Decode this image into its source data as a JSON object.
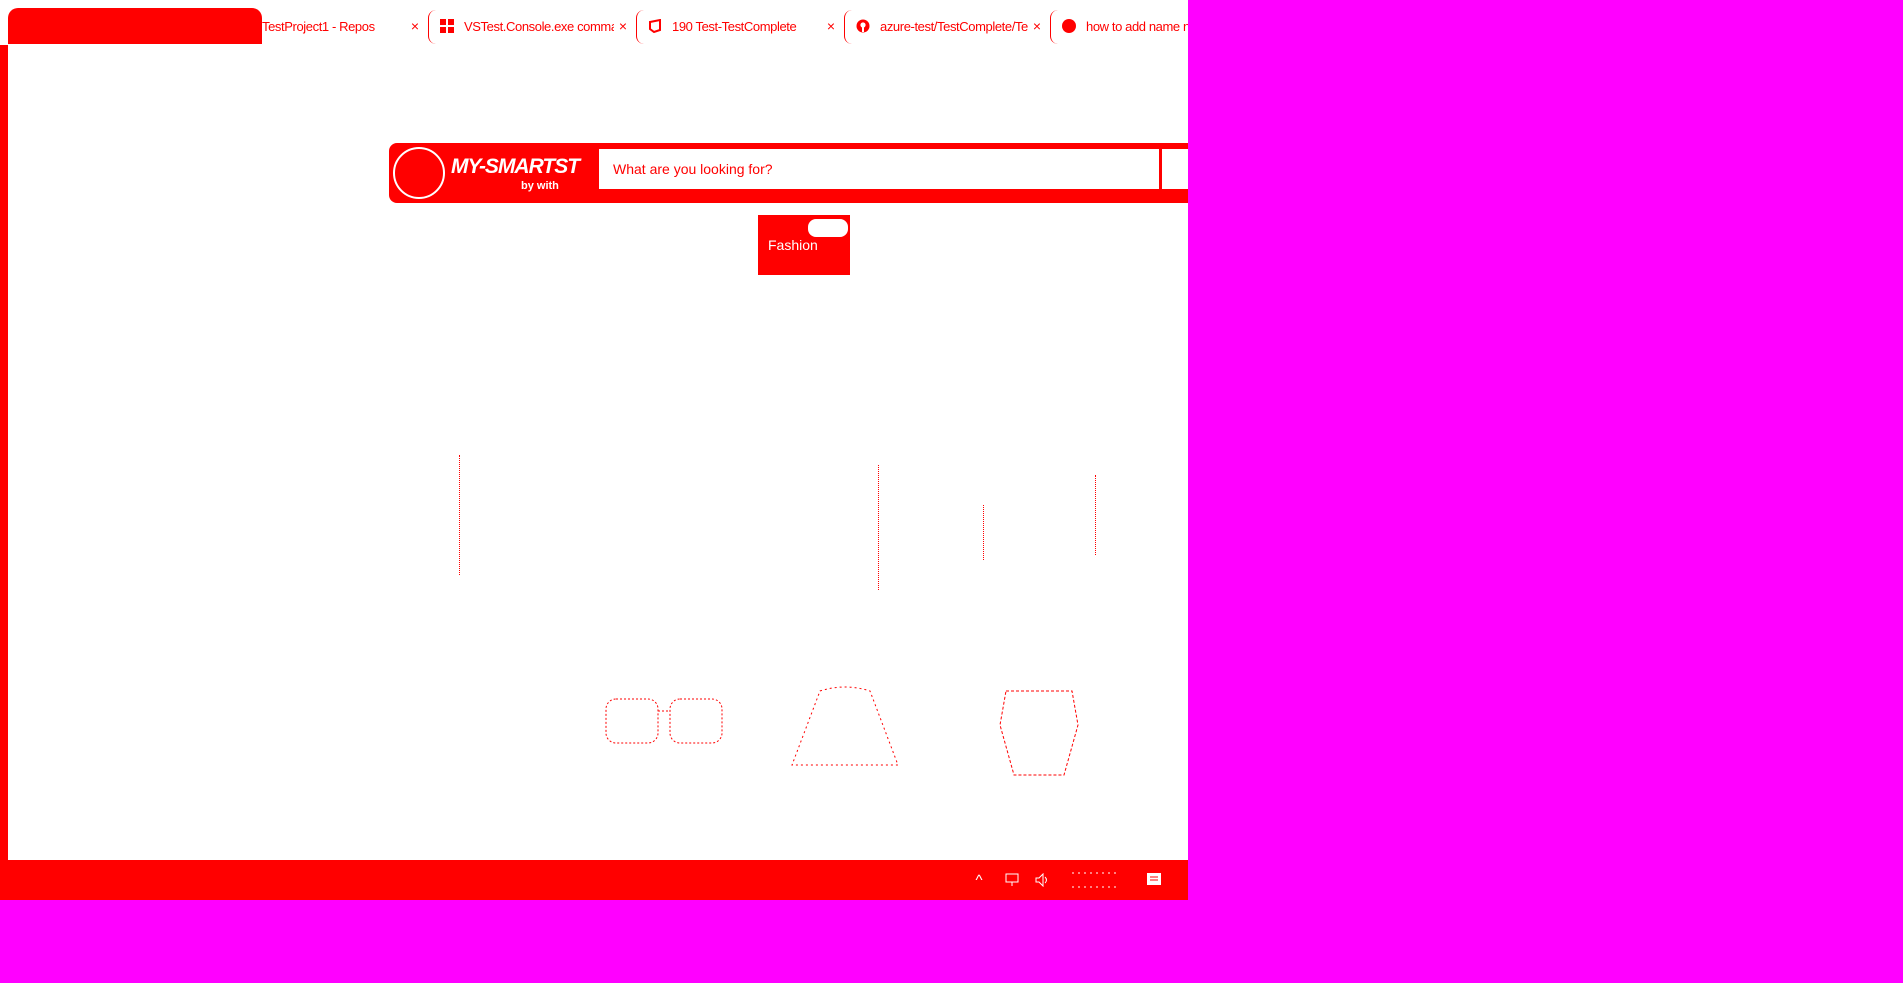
{
  "browser": {
    "tabs": [
      {
        "label": "",
        "active": true
      },
      {
        "label": "TestProject1 - Repos",
        "active": false,
        "icon": "azure-devops-icon"
      },
      {
        "label": "VSTest.Console.exe comma",
        "active": false,
        "icon": "windows-logo-icon"
      },
      {
        "label": "190 Test-TestComplete",
        "active": false,
        "icon": "testcomplete-icon"
      },
      {
        "label": "azure-test/TestComplete/Te",
        "active": false,
        "icon": "github-icon"
      },
      {
        "label": "how to add name n",
        "active": false,
        "icon": "stackoverflow-icon"
      }
    ],
    "close_glyph": "×"
  },
  "site": {
    "logo_text": "MY-SMARTST",
    "logo_sub": "by with",
    "search_placeholder": "What are you looking for?",
    "category_chip": "Fashion"
  },
  "taskbar": {
    "chevron": "^",
    "tray_icons": [
      "chevron-up-icon",
      "network-icon",
      "speaker-icon",
      "clock-area",
      "notifications-icon"
    ]
  },
  "colors": {
    "accent": "#ff0000",
    "background": "#ff00ff",
    "page": "#ffffff"
  }
}
